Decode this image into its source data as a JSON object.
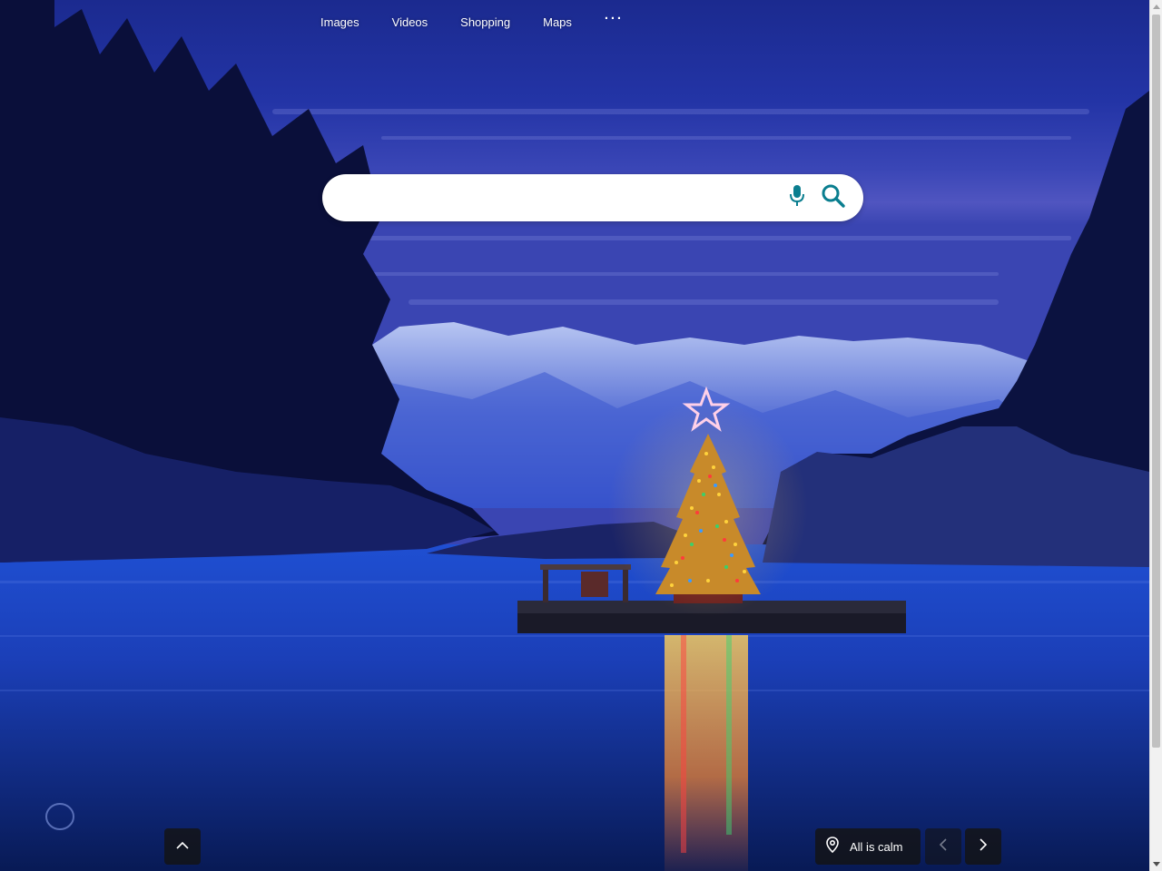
{
  "nav": {
    "items": [
      {
        "label": "Images"
      },
      {
        "label": "Videos"
      },
      {
        "label": "Shopping"
      },
      {
        "label": "Maps"
      }
    ],
    "more_label": "···"
  },
  "search": {
    "value": "",
    "placeholder": ""
  },
  "icons": {
    "mic": "microphone-icon",
    "search": "search-icon",
    "scroll_up": "chevron-up-icon",
    "location": "location-pin-icon",
    "prev": "chevron-left-icon",
    "next": "chevron-right-icon"
  },
  "caption": {
    "label": "All is calm"
  },
  "colors": {
    "accent": "#0a7e8f",
    "sky": "#2a3aa8",
    "water": "#1c49c8"
  }
}
